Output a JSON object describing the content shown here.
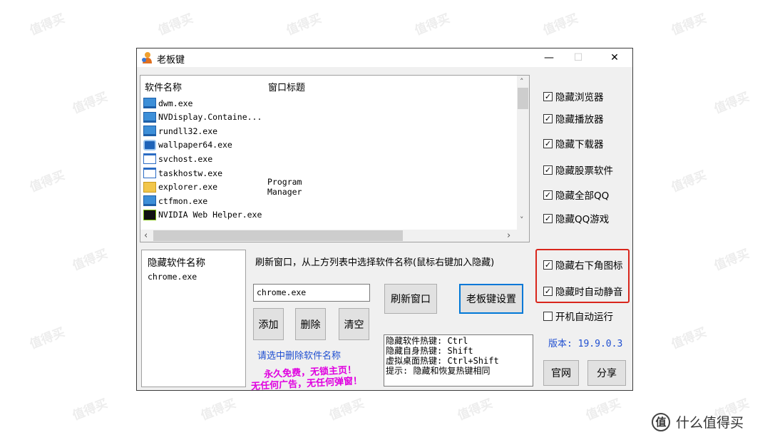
{
  "window": {
    "title": "老板键",
    "controls": {
      "minimize": "—",
      "maximize": "☐",
      "close": "✕"
    }
  },
  "process_list": {
    "columns": [
      "软件名称",
      "窗口标题"
    ],
    "rows": [
      {
        "name": "dwm.exe",
        "title": "",
        "icon": "monitor-icon"
      },
      {
        "name": "NVDisplay.Containe...",
        "title": "",
        "icon": "monitor-icon"
      },
      {
        "name": "rundll32.exe",
        "title": "",
        "icon": "monitor-icon"
      },
      {
        "name": "wallpaper64.exe",
        "title": "",
        "icon": "wallpaper-engine-icon"
      },
      {
        "name": "svchost.exe",
        "title": "",
        "icon": "service-window-icon"
      },
      {
        "name": "taskhostw.exe",
        "title": "",
        "icon": "service-window-icon"
      },
      {
        "name": "explorer.exe",
        "title": "Program Manager",
        "icon": "folder-icon"
      },
      {
        "name": "ctfmon.exe",
        "title": "",
        "icon": "monitor-icon"
      },
      {
        "name": "NVIDIA Web Helper.exe",
        "title": "",
        "icon": "nvidia-icon"
      }
    ]
  },
  "options": [
    {
      "label": "隐藏浏览器",
      "checked": true
    },
    {
      "label": "隐藏播放器",
      "checked": true
    },
    {
      "label": "隐藏下载器",
      "checked": true
    },
    {
      "label": "隐藏股票软件",
      "checked": true
    },
    {
      "label": "隐藏全部QQ",
      "checked": true
    },
    {
      "label": "隐藏QQ游戏",
      "checked": true
    },
    {
      "label": "隐藏右下角图标",
      "checked": true
    },
    {
      "label": "隐藏时自动静音",
      "checked": true
    },
    {
      "label": "开机自动运行",
      "checked": false
    }
  ],
  "hidden_list": {
    "header": "隐藏软件名称",
    "items": [
      "chrome.exe"
    ]
  },
  "controls": {
    "instruction": "刷新窗口，从上方列表中选择软件名称(鼠标右键加入隐藏)",
    "input_value": "chrome.exe",
    "add_label": "添加",
    "delete_label": "删除",
    "clear_label": "清空",
    "refresh_label": "刷新窗口",
    "settings_label": "老板键设置",
    "delete_hint": "请选中删除软件名称",
    "promo_line1": "永久免费，无锁主页！",
    "promo_line2": "无任何广告，无任何弹窗！"
  },
  "hotkeys": [
    "隐藏软件热键: Ctrl",
    "隐藏自身热键: Shift",
    "虚拟桌面热键: Ctrl+Shift",
    "提示: 隐藏和恢复热键相同"
  ],
  "version": "版本: 19.9.0.3",
  "bottom_buttons": {
    "website": "官网",
    "share": "分享"
  },
  "watermark_text": "值得买",
  "footer": {
    "logo_char": "值",
    "text": "什么值得买"
  },
  "colors": {
    "highlight_box": "#d9261c",
    "link_blue": "#1f4fd1",
    "promo_magenta": "#e000e0",
    "focus_blue": "#0078d7"
  }
}
